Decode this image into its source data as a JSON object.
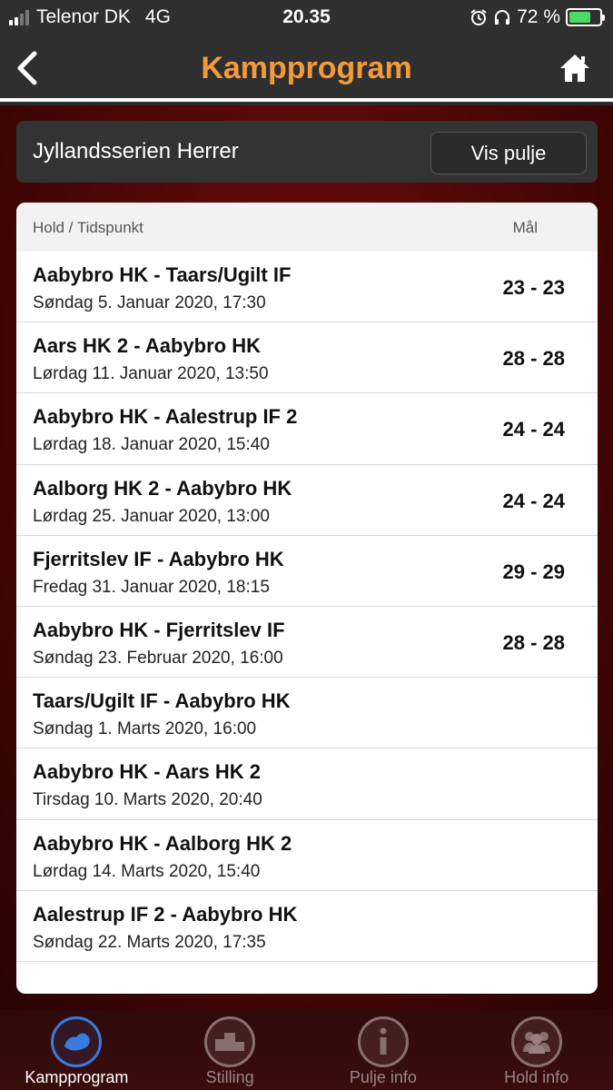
{
  "status": {
    "carrier": "Telenor DK",
    "network": "4G",
    "time": "20.35",
    "battery": "72 %",
    "battery_level": 0.72
  },
  "nav": {
    "title": "Kampprogram",
    "back_icon": "chevron-left-icon",
    "home_icon": "home-icon"
  },
  "league": {
    "name": "Jyllandsserien Herrer",
    "button_label": "Vis pulje"
  },
  "table": {
    "col_team": "Hold / Tidspunkt",
    "col_goals": "Mål",
    "rows": [
      {
        "teams": "Aabybro HK - Taars/Ugilt IF",
        "date": "Søndag 5. Januar 2020, 17:30",
        "score": "23 - 23"
      },
      {
        "teams": "Aars HK 2 - Aabybro HK",
        "date": "Lørdag 11. Januar 2020, 13:50",
        "score": "28 - 28"
      },
      {
        "teams": "Aabybro HK - Aalestrup IF 2",
        "date": "Lørdag 18. Januar 2020, 15:40",
        "score": "24 - 24"
      },
      {
        "teams": "Aalborg HK 2 - Aabybro HK",
        "date": "Lørdag 25. Januar 2020, 13:00",
        "score": "24 - 24"
      },
      {
        "teams": "Fjerritslev IF - Aabybro HK",
        "date": "Fredag 31. Januar 2020, 18:15",
        "score": "29 - 29"
      },
      {
        "teams": "Aabybro HK - Fjerritslev IF",
        "date": "Søndag 23. Februar 2020, 16:00",
        "score": "28 - 28"
      },
      {
        "teams": "Taars/Ugilt IF - Aabybro HK",
        "date": "Søndag 1. Marts 2020, 16:00",
        "score": ""
      },
      {
        "teams": "Aabybro HK - Aars HK 2",
        "date": "Tirsdag 10. Marts 2020, 20:40",
        "score": ""
      },
      {
        "teams": "Aabybro HK - Aalborg HK 2",
        "date": "Lørdag 14. Marts 2020, 15:40",
        "score": ""
      },
      {
        "teams": "Aalestrup IF 2 - Aabybro HK",
        "date": "Søndag 22. Marts 2020, 17:35",
        "score": ""
      }
    ]
  },
  "tabs": [
    {
      "label": "Kampprogram",
      "icon": "handball-icon",
      "active": true
    },
    {
      "label": "Stilling",
      "icon": "podium-icon",
      "active": false
    },
    {
      "label": "Pulje info",
      "icon": "info-icon",
      "active": false
    },
    {
      "label": "Hold info",
      "icon": "team-icon",
      "active": false
    }
  ],
  "colors": {
    "accent": "#f39a3c",
    "active_tab": "#3a7be0"
  }
}
